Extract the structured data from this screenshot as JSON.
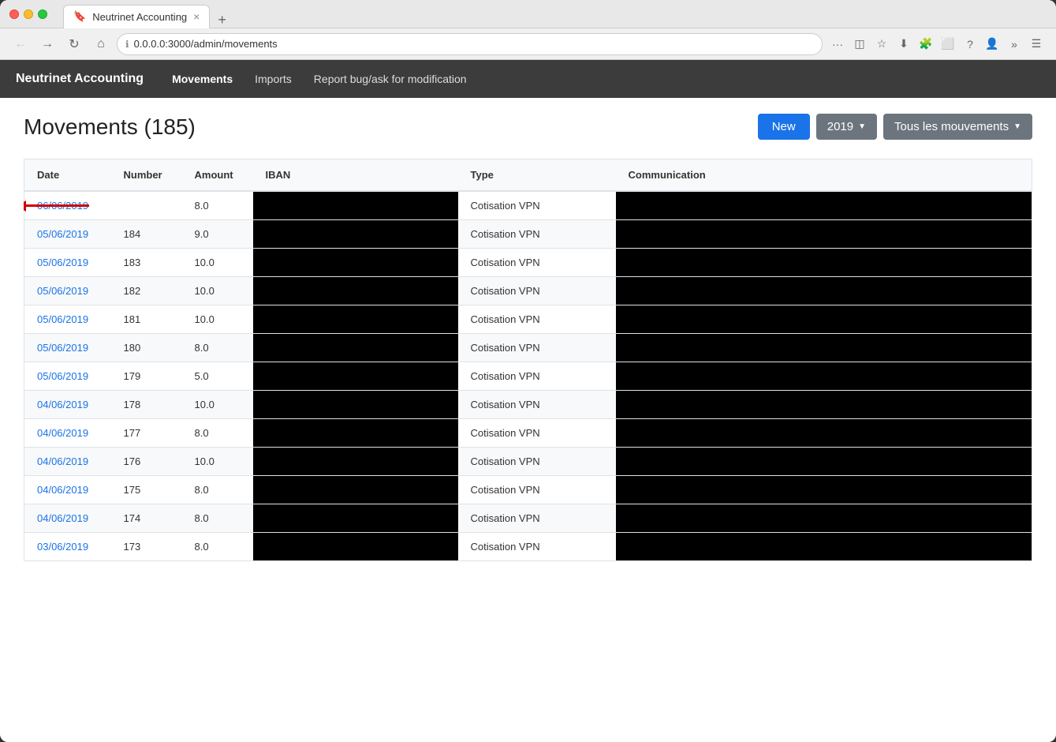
{
  "browser": {
    "tab_title": "Neutrinet Accounting",
    "url": "0.0.0.0:3000/admin/movements",
    "tab_close": "×",
    "tab_new": "+"
  },
  "app": {
    "brand": "Neutrinet Accounting",
    "nav": [
      {
        "label": "Movements",
        "active": true
      },
      {
        "label": "Imports",
        "active": false
      },
      {
        "label": "Report bug/ask for modification",
        "active": false
      }
    ]
  },
  "page": {
    "title": "Movements (185)",
    "new_button": "New",
    "year_button": "2019",
    "filter_button": "Tous les mouvements"
  },
  "table": {
    "headers": [
      "Date",
      "Number",
      "Amount",
      "IBAN",
      "Type",
      "Communication"
    ],
    "rows": [
      {
        "date": "06/06/2019",
        "number": "",
        "amount": "8.0",
        "iban": "",
        "type": "Cotisation VPN",
        "communication": ""
      },
      {
        "date": "05/06/2019",
        "number": "184",
        "amount": "9.0",
        "iban": "",
        "type": "Cotisation VPN",
        "communication": ""
      },
      {
        "date": "05/06/2019",
        "number": "183",
        "amount": "10.0",
        "iban": "",
        "type": "Cotisation VPN",
        "communication": ""
      },
      {
        "date": "05/06/2019",
        "number": "182",
        "amount": "10.0",
        "iban": "",
        "type": "Cotisation VPN",
        "communication": ""
      },
      {
        "date": "05/06/2019",
        "number": "181",
        "amount": "10.0",
        "iban": "",
        "type": "Cotisation VPN",
        "communication": ""
      },
      {
        "date": "05/06/2019",
        "number": "180",
        "amount": "8.0",
        "iban": "",
        "type": "Cotisation VPN",
        "communication": ""
      },
      {
        "date": "05/06/2019",
        "number": "179",
        "amount": "5.0",
        "iban": "",
        "type": "Cotisation VPN",
        "communication": ""
      },
      {
        "date": "04/06/2019",
        "number": "178",
        "amount": "10.0",
        "iban": "",
        "type": "Cotisation VPN",
        "communication": ""
      },
      {
        "date": "04/06/2019",
        "number": "177",
        "amount": "8.0",
        "iban": "",
        "type": "Cotisation VPN",
        "communication": ""
      },
      {
        "date": "04/06/2019",
        "number": "176",
        "amount": "10.0",
        "iban": "",
        "type": "Cotisation VPN",
        "communication": ""
      },
      {
        "date": "04/06/2019",
        "number": "175",
        "amount": "8.0",
        "iban": "",
        "type": "Cotisation VPN",
        "communication": ""
      },
      {
        "date": "04/06/2019",
        "number": "174",
        "amount": "8.0",
        "iban": "",
        "type": "Cotisation VPN",
        "communication": ""
      },
      {
        "date": "03/06/2019",
        "number": "173",
        "amount": "8.0",
        "iban": "",
        "type": "Cotisation VPN",
        "communication": ""
      }
    ]
  },
  "colors": {
    "primary_blue": "#1a73e8",
    "header_bg": "#3c3c3c",
    "arrow_red": "#cc0000",
    "btn_gray": "#6c757d"
  }
}
